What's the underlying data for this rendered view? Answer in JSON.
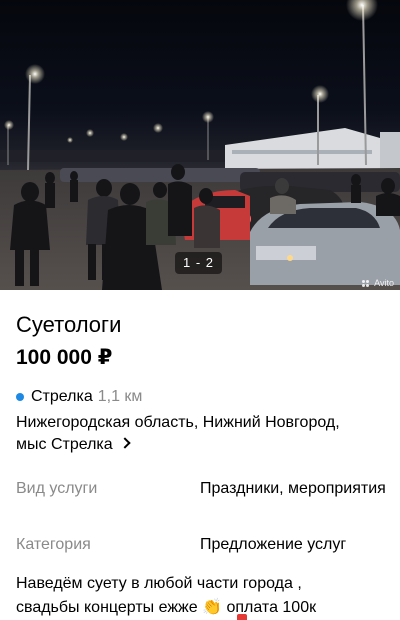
{
  "gallery": {
    "counter": "1 - 2",
    "watermark": "Avito"
  },
  "listing": {
    "title": "Суетологи",
    "price": "100 000 ₽"
  },
  "location": {
    "metro_color": "#1e88e5",
    "metro_name": "Стрелка",
    "metro_distance": "1,1 км",
    "address_line1": "Нижегородская область, Нижний Новгород,",
    "address_line2": "мыс Стрелка"
  },
  "params": [
    {
      "label": "Вид услуги",
      "value": "Праздники, мероприятия"
    },
    {
      "label": "Категория",
      "value": "Предложение услуг"
    }
  ],
  "description": {
    "line1": "Наведём суету в любой части города ,",
    "line2_before": "свадьбы концерты ежже",
    "emoji": "👏",
    "line2_after": "оплата 100к"
  }
}
